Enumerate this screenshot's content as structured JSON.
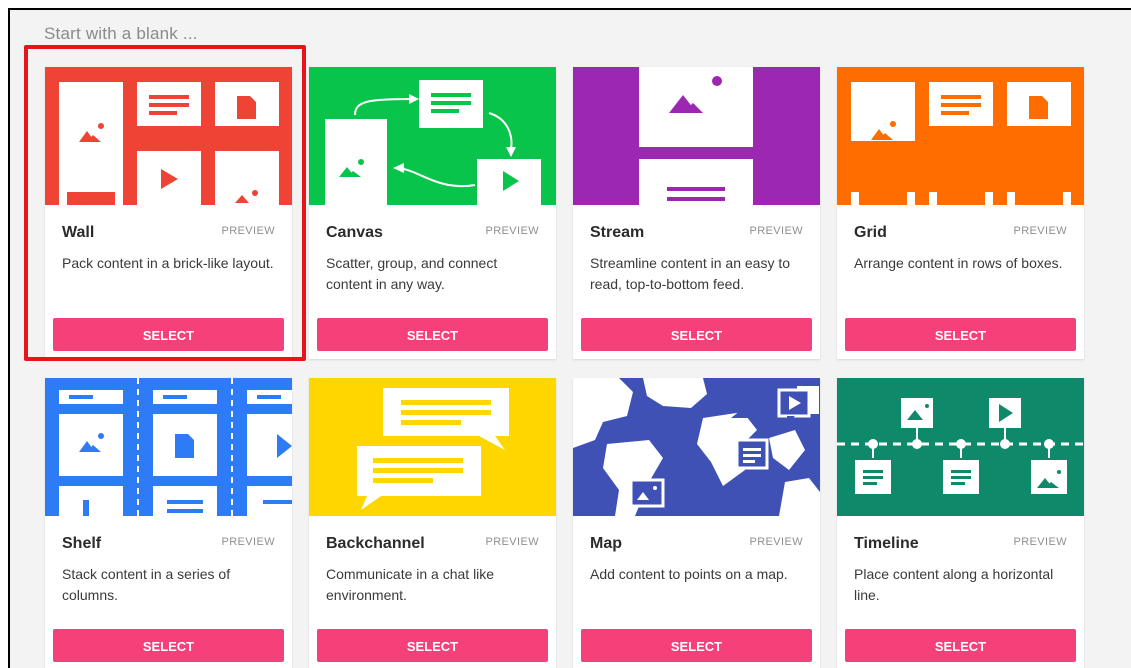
{
  "heading": "Start with a blank ...",
  "colors": {
    "select_button": "#f5407a",
    "highlight": "#e8141c",
    "wall": "#ef4336",
    "canvas": "#09c44b",
    "stream": "#9c27b0",
    "grid": "#ff6d00",
    "shelf": "#2d7cf6",
    "backchannel": "#ffd600",
    "map": "#3f51b5",
    "timeline": "#0e8a6b"
  },
  "layouts": [
    {
      "name": "Wall",
      "preview": "PREVIEW",
      "description": "Pack content in a brick-like layout.",
      "button": "SELECT",
      "selected": true
    },
    {
      "name": "Canvas",
      "preview": "PREVIEW",
      "description": "Scatter, group, and connect content in any way.",
      "button": "SELECT"
    },
    {
      "name": "Stream",
      "preview": "PREVIEW",
      "description": "Streamline content in an easy to read, top-to-bottom feed.",
      "button": "SELECT"
    },
    {
      "name": "Grid",
      "preview": "PREVIEW",
      "description": "Arrange content in rows of boxes.",
      "button": "SELECT"
    },
    {
      "name": "Shelf",
      "preview": "PREVIEW",
      "description": "Stack content in a series of columns.",
      "button": "SELECT"
    },
    {
      "name": "Backchannel",
      "preview": "PREVIEW",
      "description": "Communicate in a chat like environment.",
      "button": "SELECT"
    },
    {
      "name": "Map",
      "preview": "PREVIEW",
      "description": "Add content to points on a map.",
      "button": "SELECT"
    },
    {
      "name": "Timeline",
      "preview": "PREVIEW",
      "description": "Place content along a horizontal line.",
      "button": "SELECT"
    }
  ]
}
